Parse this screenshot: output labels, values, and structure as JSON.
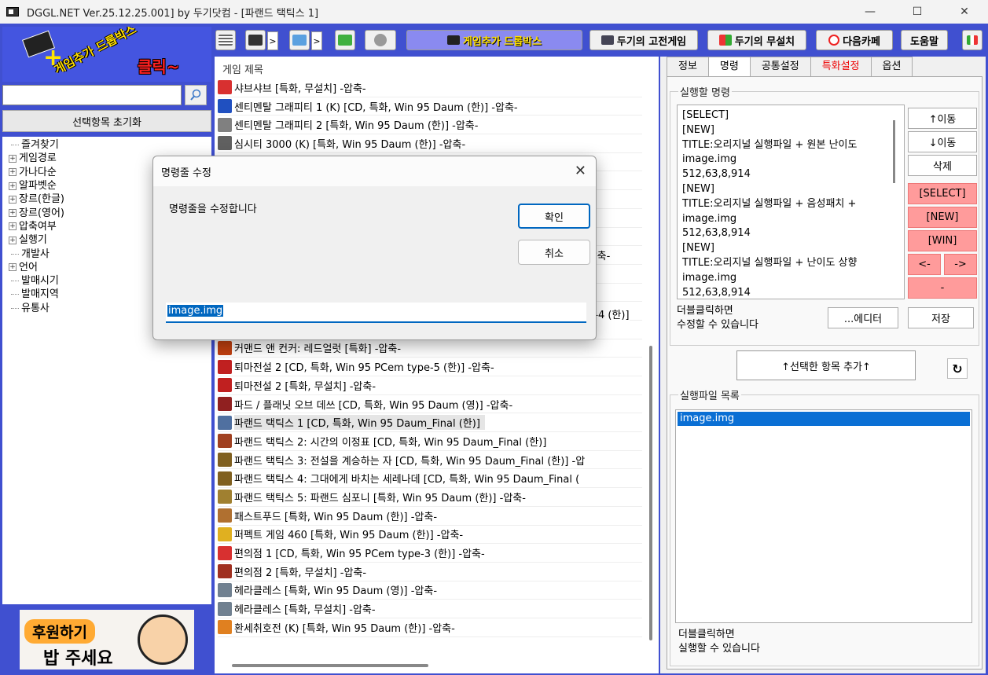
{
  "window": {
    "title": "DGGL.NET Ver.25.12.25.001] by 두기닷컴 - [파랜드 택틱스 1]",
    "minimize": "—",
    "maximize": "☐",
    "close": "✕"
  },
  "left": {
    "banner_text1": "게임추가 드롭박스",
    "banner_text2": "클릭~",
    "search_value": "",
    "reset_label": "선택항목 초기화",
    "tree": [
      {
        "label": "즐겨찾기",
        "expandable": false
      },
      {
        "label": "게임경로",
        "expandable": true
      },
      {
        "label": "가나다순",
        "expandable": true
      },
      {
        "label": "알파벳순",
        "expandable": true
      },
      {
        "label": "장르(한글)",
        "expandable": true
      },
      {
        "label": "장르(영어)",
        "expandable": true
      },
      {
        "label": "압축여부",
        "expandable": true
      },
      {
        "label": "실행기",
        "expandable": true
      },
      {
        "label": "개발사",
        "expandable": false
      },
      {
        "label": "언어",
        "expandable": true
      },
      {
        "label": "발매시기",
        "expandable": false
      },
      {
        "label": "발매지역",
        "expandable": false
      },
      {
        "label": "유통사",
        "expandable": false
      }
    ],
    "donate_text1": "후원하기",
    "donate_text2": "밥 주세요"
  },
  "toolbar": {
    "dropbox": "게임추가 드롭박스",
    "classic": "두기의 고전게임",
    "free": "두기의 무설치",
    "nextgame": "다음카페",
    "help": "도움말",
    "arrow": ">"
  },
  "games": {
    "header": "게임 제목",
    "rows": [
      {
        "title": "샤브샤브 [특화, 무설치] -압축-",
        "color": "#d83030"
      },
      {
        "title": "센티멘탈 그래피티 1 (K) [CD, 특화, Win 95 Daum (한)] -압축-",
        "color": "#2050c0"
      },
      {
        "title": "센티멘탈 그래피티 2 [특화, Win 95 Daum (한)] -압축-",
        "color": "#808080"
      },
      {
        "title": "심시티 3000 (K) [특화, Win 95 Daum (한)] -압축-",
        "color": "#606060"
      },
      {
        "title": "",
        "color": ""
      },
      {
        "title": "",
        "color": ""
      },
      {
        "title": "",
        "color": ""
      },
      {
        "title": "",
        "color": ""
      },
      {
        "title": "",
        "color": ""
      },
      {
        "title": "",
        "color": ""
      },
      {
        "title": "",
        "color": ""
      },
      {
        "title": "",
        "color": ""
      },
      {
        "title": "",
        "color": ""
      },
      {
        "title": "",
        "color": ""
      },
      {
        "title": "커맨드 앤 컨커: 레드얼럿 [특화] -압축-",
        "color": "#c04010"
      },
      {
        "title": "퇴마전설 2 [CD, 특화, Win 95 PCem type-5 (한)] -압축-",
        "color": "#c02020"
      },
      {
        "title": "퇴마전설 2 [특화, 무설치] -압축-",
        "color": "#c02020"
      },
      {
        "title": "파드 / 플래닛 오브 데쓰 [CD, 특화, Win 95 Daum (영)] -압축-",
        "color": "#902020"
      },
      {
        "title": "파랜드 택틱스 1 [CD, 특화, Win 95 Daum_Final (한)]",
        "color": "#5070a0",
        "selected": true
      },
      {
        "title": "파랜드 택틱스 2: 시간의 이정표 [CD, 특화, Win 95 Daum_Final (한)]",
        "color": "#a04020"
      },
      {
        "title": "파랜드 택틱스 3: 전설을 계승하는 자 [CD, 특화, Win 95 Daum_Final (한)] -압",
        "color": "#806020"
      },
      {
        "title": "파랜드 택틱스 4: 그대에게 바치는 세레나데 [CD, 특화, Win 95 Daum_Final (",
        "color": "#806020"
      },
      {
        "title": "파랜드 택틱스 5: 파랜드 심포니 [특화, Win 95 Daum (한)] -압축-",
        "color": "#a08030"
      },
      {
        "title": "패스트푸드 [특화, Win 95 Daum (한)] -압축-",
        "color": "#b07030"
      },
      {
        "title": "퍼펙트 게임 460 [특화, Win 95 Daum (한)] -압축-",
        "color": "#e0b020"
      },
      {
        "title": "편의점 1 [CD, 특화, Win 95 PCem type-3 (한)] -압축-",
        "color": "#d83030"
      },
      {
        "title": "편의점 2 [특화, 무설치] -압축-",
        "color": "#a03020"
      },
      {
        "title": "헤라클레스 [특화, Win 95 Daum (영)] -압축-",
        "color": "#708090"
      },
      {
        "title": "헤라클레스 [특화, 무설치] -압축-",
        "color": "#708090"
      },
      {
        "title": "환세취호전 (K) [특화, Win 95 Daum (한)] -압축-",
        "color": "#e08020"
      }
    ],
    "partial_text_a": "-압축-",
    "partial_text_b": "pe-4 (한)]"
  },
  "right": {
    "tabs": [
      {
        "label": "정보",
        "active": false,
        "red": false
      },
      {
        "label": "명령",
        "active": true,
        "red": false
      },
      {
        "label": "공통설정",
        "active": false,
        "red": false
      },
      {
        "label": "특화설정",
        "active": false,
        "red": true
      },
      {
        "label": "옵션",
        "active": false,
        "red": false
      }
    ],
    "group1_label": "실행할 명령",
    "commands": [
      "[SELECT]",
      "[NEW]",
      "TITLE:오리지널 실행파일 + 원본 난이도",
      "image.img",
      "512,63,8,914",
      "[NEW]",
      "TITLE:오리지널 실행파일 + 음성패치 +",
      "image.img",
      "512,63,8,914",
      "[NEW]",
      "TITLE:오리지널 실행파일 + 난이도 상향",
      "image.img",
      "512,63,8,914"
    ],
    "btn_up": "↑이동",
    "btn_down": "↓이동",
    "btn_delete": "삭제",
    "btn_select": "[SELECT]",
    "btn_new": "[NEW]",
    "btn_win": "[WIN]",
    "btn_left": "<-",
    "btn_right": "->",
    "btn_dash": "-",
    "hint1_a": "더블클릭하면",
    "hint1_b": "수정할 수 있습니다",
    "btn_editor": "...에디터",
    "btn_save": "저장",
    "btn_add": "↑선택한 항목 추가↑",
    "btn_refresh": "↻",
    "group2_label": "실행파일 목록",
    "exe_items": [
      "image.img"
    ],
    "hint2_a": "더블클릭하면",
    "hint2_b": "실행할 수 있습니다"
  },
  "dialog": {
    "title": "명령줄 수정",
    "message": "명령줄을 수정합니다",
    "ok": "확인",
    "cancel": "취소",
    "input_value": "image.img",
    "close": "✕"
  }
}
